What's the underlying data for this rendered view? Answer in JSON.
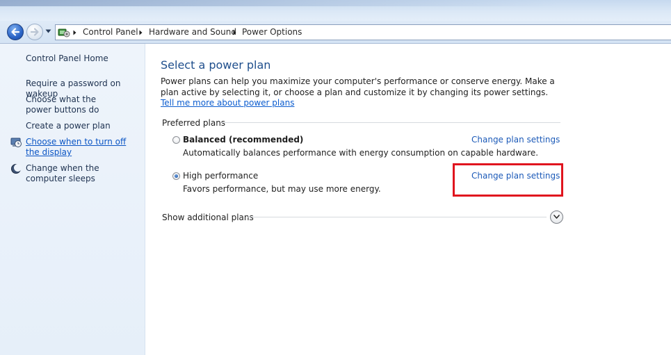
{
  "breadcrumb": {
    "items": [
      "Control Panel",
      "Hardware and Sound",
      "Power Options"
    ]
  },
  "sidebar": {
    "home": "Control Panel Home",
    "items": [
      {
        "label": "Require a password on wakeup"
      },
      {
        "label": "Choose what the power buttons do"
      },
      {
        "label": "Create a power plan"
      },
      {
        "label": "Choose when to turn off the display",
        "icon": "monitor-clock-icon",
        "active": true
      },
      {
        "label": "Change when the computer sleeps",
        "icon": "moon-icon"
      }
    ]
  },
  "main": {
    "title": "Select a power plan",
    "description": "Power plans can help you maximize your computer's performance or conserve energy. Make a plan active by selecting it, or choose a plan and customize it by changing its power settings.",
    "learn_more_link": "Tell me more about power plans",
    "preferred_label": "Preferred plans",
    "plans": [
      {
        "name": "Balanced (recommended)",
        "description": "Automatically balances performance with energy consumption on capable hardware.",
        "link": "Change plan settings",
        "selected": false
      },
      {
        "name": "High performance",
        "description": "Favors performance, but may use more energy.",
        "link": "Change plan settings",
        "selected": true
      }
    ],
    "additional_label": "Show additional plans"
  },
  "colors": {
    "highlight": "#e0141e",
    "link": "#1c5ab8",
    "title": "#1e4e8c"
  }
}
